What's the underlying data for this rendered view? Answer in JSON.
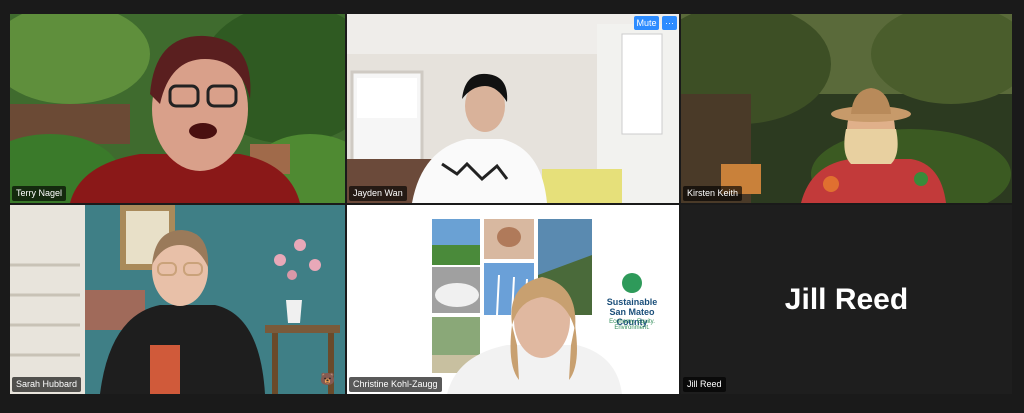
{
  "participants": [
    {
      "name": "Terry Nagel",
      "active_speaker": true
    },
    {
      "name": "Jayden Wan"
    },
    {
      "name": "Kirsten Keith"
    },
    {
      "name": "Sarah Hubbard"
    },
    {
      "name": "Christine Kohl-Zaugg"
    },
    {
      "name": "Jill Reed",
      "video_off": true
    }
  ],
  "controls": {
    "mute_label": "Mute",
    "more_label": "···"
  },
  "slide": {
    "title_line1": "Sustainable",
    "title_line2": "San Mateo County",
    "tagline": "Economy. Equity. Environment."
  },
  "colors": {
    "active_border": "#d8e04a",
    "button_blue": "#2d8cff",
    "tile_bg_off": "#2a2a2a"
  }
}
